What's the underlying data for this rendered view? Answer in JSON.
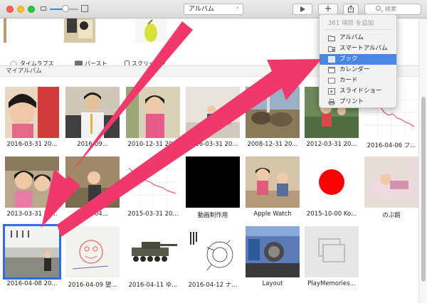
{
  "toolbar": {
    "album_select": "アルバム",
    "search_placeholder": "検索",
    "zoom_level": 0.55
  },
  "top_categories": [
    {
      "label": "タイムラプス"
    },
    {
      "label": "バースト"
    },
    {
      "label": "スクリーンシ"
    }
  ],
  "section": {
    "title": "マイアルバム"
  },
  "albums": [
    {
      "caption": "2016-03-31 20..."
    },
    {
      "caption": "2016-09..."
    },
    {
      "caption": "2010-12-31 20..."
    },
    {
      "caption": "2016-03-31 20..."
    },
    {
      "caption": "2008-12-31 20..."
    },
    {
      "caption": "2012-03-31 20..."
    },
    {
      "caption": "2016-04-06 フ..."
    },
    {
      "caption": "2013-03-31 20..."
    },
    {
      "caption": "2016-04..."
    },
    {
      "caption": "2015-03-31 20..."
    },
    {
      "caption": "動画制作用"
    },
    {
      "caption": "Apple Watch"
    },
    {
      "caption": "2015-10-00 Ko..."
    },
    {
      "caption": "のぶ館"
    },
    {
      "caption": "2016-04-08 20..."
    },
    {
      "caption": "2016-04-09 望..."
    },
    {
      "caption": "2016-04-11 ゆ..."
    },
    {
      "caption": "2016-04-12 ナ..."
    },
    {
      "caption": "Layout"
    },
    {
      "caption": "PlayMemories..."
    }
  ],
  "menu": {
    "header": "361 項目 を追加",
    "items": [
      {
        "label": "アルバム",
        "icon": "folder-icon"
      },
      {
        "label": "スマートアルバム",
        "icon": "smart-album-icon"
      },
      {
        "label": "ブック",
        "icon": "book-icon"
      },
      {
        "label": "カレンダー",
        "icon": "calendar-icon"
      },
      {
        "label": "カード",
        "icon": "card-icon"
      },
      {
        "label": "スライドショー",
        "icon": "slideshow-icon"
      },
      {
        "label": "プリント",
        "icon": "print-icon"
      }
    ],
    "active_index": 2
  },
  "colors": {
    "arrow": "#f0386b",
    "selection": "#2f6ce0",
    "menu_highlight": "#4a86e8"
  }
}
